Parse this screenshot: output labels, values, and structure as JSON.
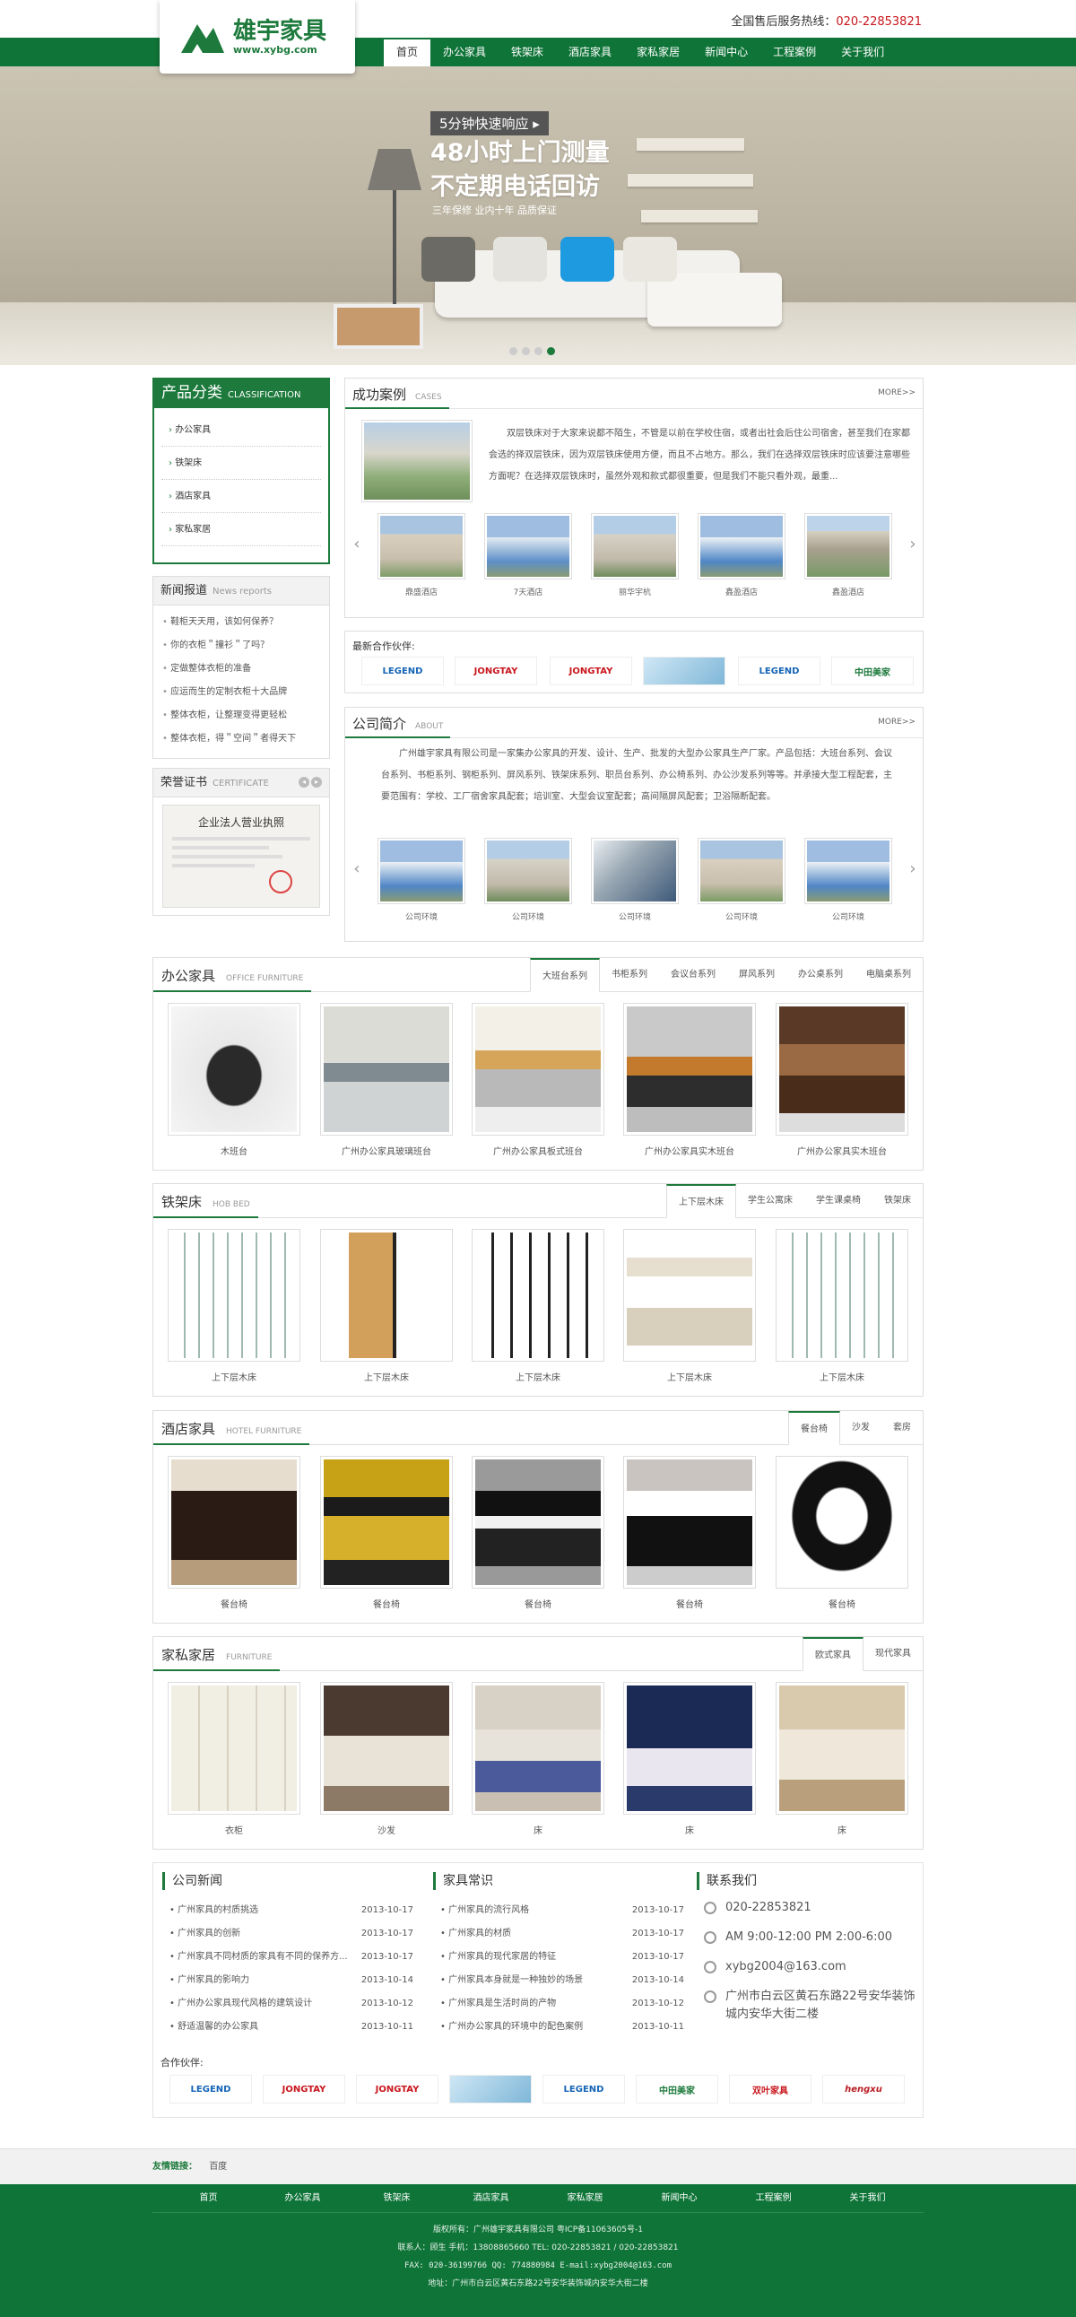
{
  "header": {
    "logo_title": "雄宇家具",
    "logo_url": "www.xybg.com",
    "hotline_label": "全国售后服务热线：",
    "hotline_number": "020-22853821"
  },
  "nav": [
    "首页",
    "办公家具",
    "铁架床",
    "酒店家具",
    "家私家居",
    "新闻中心",
    "工程案例",
    "关于我们"
  ],
  "banner": {
    "tag": "5分钟快速响应 ▸",
    "line1": "48小时上门测量",
    "line2": "不定期电话回访",
    "sub": "三年保修  业内十年  品质保证"
  },
  "category": {
    "title": "产品分类",
    "title_en": "CLASSIFICATION",
    "items": [
      "办公家具",
      "铁架床",
      "酒店家具",
      "家私家居"
    ]
  },
  "news_box": {
    "title": "新闻报道",
    "title_en": "News reports",
    "items": [
      "鞋柜天天用，该如何保养？",
      "你的衣柜＂撞衫＂了吗？",
      "定做整体衣柜的准备",
      "应运而生的定制衣柜十大品牌",
      "整体衣柜，让整理变得更轻松",
      "整体衣柜，得＂空间＂者得天下"
    ]
  },
  "cert": {
    "title": "荣誉证书",
    "title_en": "CERTIFICATE",
    "doc_title": "企业法人营业执照"
  },
  "cases": {
    "title": "成功案例",
    "title_en": "CASES",
    "more": "MORE>>",
    "text": "双层铁床对于大家来说都不陌生，不管是以前在学校住宿，或者出社会后住公司宿舍，甚至我们在家都会选的择双层铁床，因为双层铁床使用方便，而且不占地方。那么，我们在选择双层铁床时应该要注意哪些方面呢？在选择双层铁床时，虽然外观和款式都很重要，但是我们不能只看外观，最重...",
    "items": [
      "鼎盛酒店",
      "7天酒店",
      "丽华宇杭",
      "鑫盈酒店",
      "鑫盈酒店"
    ]
  },
  "partners_top": {
    "title": "最新合作伙伴:",
    "items": [
      "LEGEND",
      "JONGTAY",
      "JONGTAY",
      "",
      "LEGEND",
      "中田美家"
    ]
  },
  "about": {
    "title": "公司简介",
    "title_en": "ABOUT",
    "more": "MORE>>",
    "text": "广州雄宇家具有限公司是一家集办公家具的开发、设计、生产、批发的大型办公家具生产厂家。产品包括：大班台系列、会议台系列、书柜系列、钢柜系列、屏风系列、铁架床系列、职员台系列、办公椅系列、办公沙发系列等等。并承接大型工程配套，主要范围有：学校、工厂宿舍家具配套；培训室、大型会议室配套；高间隔屏风配套；卫浴隔断配套。",
    "items": [
      "公司环境",
      "公司环境",
      "公司环境",
      "公司环境",
      "公司环境"
    ]
  },
  "office": {
    "title": "办公家具",
    "title_en": "OFFICE FURNITURE",
    "tabs": [
      "大班台系列",
      "书柜系列",
      "会议台系列",
      "屏风系列",
      "办公桌系列",
      "电脑桌系列"
    ],
    "items": [
      "木班台",
      "广州办公家具玻璃班台",
      "广州办公家具板式班台",
      "广州办公家具实木班台",
      "广州办公家具实木班台"
    ]
  },
  "bed": {
    "title": "铁架床",
    "title_en": "HOB BED",
    "tabs": [
      "上下层木床",
      "学生公寓床",
      "学生课桌椅",
      "铁架床"
    ],
    "items": [
      "上下层木床",
      "上下层木床",
      "上下层木床",
      "上下层木床",
      "上下层木床"
    ]
  },
  "hotel": {
    "title": "酒店家具",
    "title_en": "HOTEL FURNITURE",
    "tabs": [
      "餐台椅",
      "沙发",
      "套房"
    ],
    "items": [
      "餐台椅",
      "餐台椅",
      "餐台椅",
      "餐台椅",
      "餐台椅"
    ]
  },
  "home": {
    "title": "家私家居",
    "title_en": "FURNITURE",
    "tabs": [
      "欧式家具",
      "现代家具"
    ],
    "items": [
      "衣柜",
      "沙发",
      "床",
      "床",
      "床"
    ]
  },
  "company_news": {
    "title": "公司新闻",
    "items": [
      {
        "t": "广州家具的村质挑选",
        "d": "2013-10-17"
      },
      {
        "t": "广州家具的创新",
        "d": "2013-10-17"
      },
      {
        "t": "广州家具不同材质的家具有不同的保养方...",
        "d": "2013-10-17"
      },
      {
        "t": "广州家具的影响力",
        "d": "2013-10-14"
      },
      {
        "t": "广州办公家具现代风格的建筑设计",
        "d": "2013-10-12"
      },
      {
        "t": "舒适温馨的办公家具",
        "d": "2013-10-11"
      }
    ]
  },
  "furniture_tips": {
    "title": "家具常识",
    "items": [
      {
        "t": "广州家具的流行风格",
        "d": "2013-10-17"
      },
      {
        "t": "广州家具的材质",
        "d": "2013-10-17"
      },
      {
        "t": "广州家具的现代家居的特征",
        "d": "2013-10-17"
      },
      {
        "t": "广州家具本身就是一种独妙的场景",
        "d": "2013-10-14"
      },
      {
        "t": "广州家具是生活时尚的产物",
        "d": "2013-10-12"
      },
      {
        "t": "广州办公家具的环境中的配色案例",
        "d": "2013-10-11"
      }
    ]
  },
  "contact": {
    "title": "联系我们",
    "phone": "020-22853821",
    "hours": "AM 9:00-12:00 PM 2:00-6:00",
    "email": "xybg2004@163.com",
    "address": "广州市白云区黄石东路22号安华装饰城内安华大街二楼"
  },
  "partners_bottom": {
    "title": "合作伙伴:",
    "items": [
      "LEGEND",
      "JONGTAY",
      "JONGTAY",
      "",
      "LEGEND",
      "中田美家",
      "双叶家具",
      "hengxu"
    ]
  },
  "friend_links": {
    "label": "友情链接：",
    "items": [
      "百度"
    ]
  },
  "footer": {
    "nav": [
      "首页",
      "办公家具",
      "铁架床",
      "酒店家具",
      "家私家居",
      "新闻中心",
      "工程案例",
      "关于我们"
    ],
    "line1": "版权所有：广州雄宇家具有限公司 粤ICP备11063605号-1",
    "line2": "联系人：顾生 手机：13808865660 TEL: 020-22853821 / 020-22853821",
    "line3": "FAX: 020-36199766 QQ: 774880984 E-mail:xybg2004@163.com",
    "line4": "地址：广州市白云区黄石东路22号安华装饰城内安华大街二楼"
  },
  "colors": {
    "brand": "#1d7a3c",
    "hotline": "#c8161d",
    "footer": "#0f7438"
  }
}
